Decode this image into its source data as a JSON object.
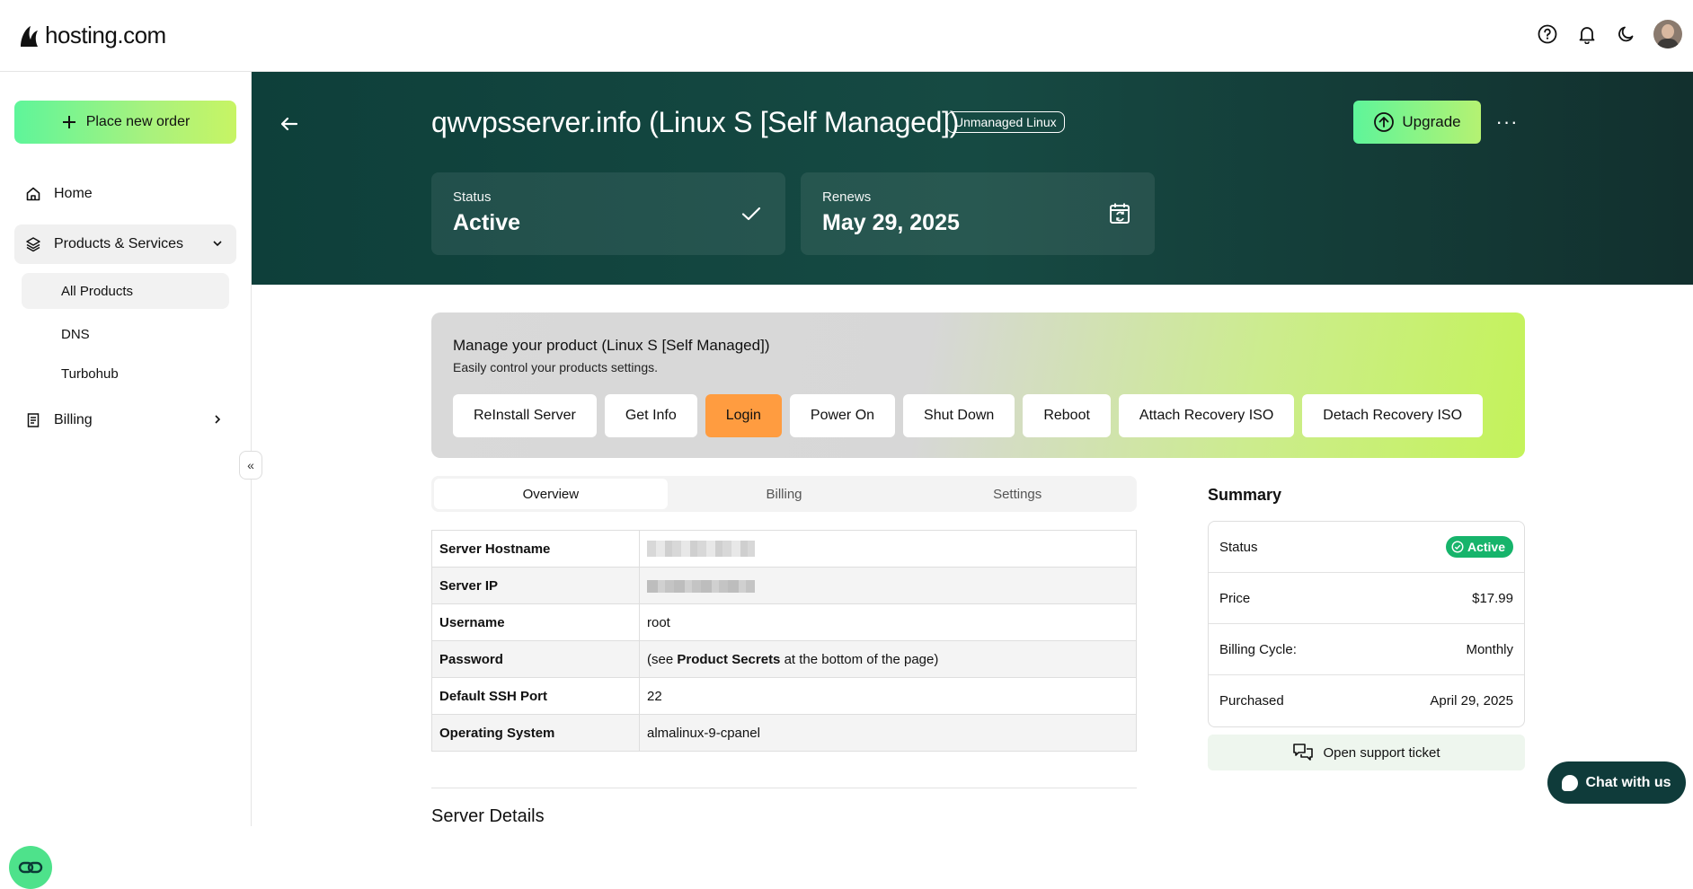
{
  "brand": {
    "name": "hosting.com"
  },
  "topbar": {
    "icons": [
      "help-icon",
      "bell-icon",
      "moon-icon"
    ]
  },
  "sidebar": {
    "order_button": "Place new order",
    "items": [
      {
        "label": "Home",
        "icon": "home-icon"
      },
      {
        "label": "Products & Services",
        "icon": "layers-icon"
      },
      {
        "label": "Billing",
        "icon": "receipt-icon"
      }
    ],
    "sub_items": [
      {
        "label": "All Products"
      },
      {
        "label": "DNS"
      },
      {
        "label": "Turbohub"
      }
    ],
    "collapse_glyph": "«"
  },
  "hero": {
    "title": "qwvpsserver.info (Linux S [Self Managed])",
    "badge": "Unmanaged Linux",
    "upgrade_label": "Upgrade",
    "more_label": "···",
    "status": {
      "label": "Status",
      "value": "Active"
    },
    "renews": {
      "label": "Renews",
      "value": "May 29, 2025"
    }
  },
  "manage": {
    "title": "Manage your product (Linux S [Self Managed])",
    "subtitle": "Easily control your products settings.",
    "actions": [
      "ReInstall Server",
      "Get Info",
      "Login",
      "Power On",
      "Shut Down",
      "Reboot",
      "Attach Recovery ISO",
      "Detach Recovery ISO"
    ],
    "accent": "#ff9c40"
  },
  "tabs": [
    "Overview",
    "Billing",
    "Settings"
  ],
  "details": {
    "rows": [
      {
        "key": "Server Hostname",
        "value": ""
      },
      {
        "key": "Server IP",
        "value": ""
      },
      {
        "key": "Username",
        "value": "root"
      },
      {
        "key": "Password",
        "value_pre": "(see ",
        "value_bold": "Product Secrets",
        "value_post": " at the bottom of the page)"
      },
      {
        "key": "Default SSH Port",
        "value": "22"
      },
      {
        "key": "Operating System",
        "value": "almalinux-9-cpanel"
      }
    ]
  },
  "server_details_heading": "Server Details",
  "summary": {
    "title": "Summary",
    "status_label": "Status",
    "status_value": "Active",
    "price_label": "Price",
    "price_value": "$17.99",
    "cycle_label": "Billing Cycle:",
    "cycle_value": "Monthly",
    "purchased_label": "Purchased",
    "purchased_value": "April 29, 2025",
    "support_label": "Open support ticket"
  },
  "chat": {
    "label": "Chat with us"
  },
  "colors": {
    "hero_bg": "#0e3f3a",
    "brand_green": "#5ef59a",
    "status_green": "#16b46b"
  }
}
